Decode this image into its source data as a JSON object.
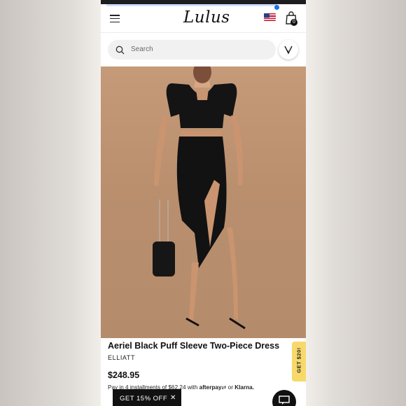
{
  "header": {
    "logo": "Lulus",
    "cart_count": "0",
    "menu_icon": "hamburger-menu-icon",
    "flag_icon": "us-flag-icon",
    "bag_icon": "shopping-bag-icon"
  },
  "search": {
    "placeholder": "Search",
    "wishlist_icon": "heart-icon"
  },
  "gallery": {
    "image_count": 8,
    "active_index": 0
  },
  "product": {
    "title": "Aeriel Black Puff Sleeve Two-Piece Dress",
    "brand": "ELLIATT",
    "price": "$248.95",
    "installments_prefix": "Pay in 4 installments of",
    "installment_amount": "$62.24",
    "installments_with": "with",
    "afterpay_label": "afterpay",
    "or_label": "or",
    "klarna_label": "Klarna."
  },
  "promo": {
    "side_tab": "GET $20!",
    "banner": "GET 15% OFF"
  },
  "colors": {
    "image_bg": "#b98f6e",
    "promo_tab": "#f7d86a",
    "accent": "#1a73e8"
  }
}
